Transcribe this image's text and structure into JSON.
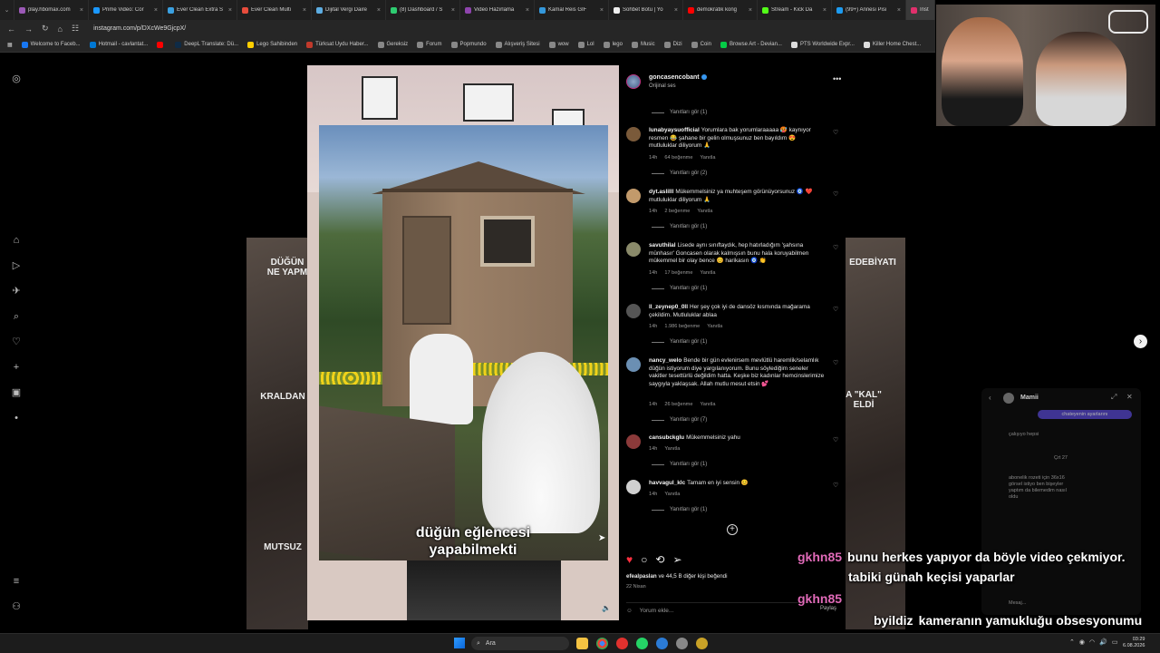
{
  "browser": {
    "tabs": [
      {
        "label": "play.hbomax.com",
        "color": "#9b59b6"
      },
      {
        "label": "Prime Video: Cor",
        "color": "#1a98ff"
      },
      {
        "label": "Ever Clean Extra S",
        "color": "#3aa0e0"
      },
      {
        "label": "Ever Clean Multi",
        "color": "#e74c3c"
      },
      {
        "label": "Dijital Vergi Daire",
        "color": "#5dade2"
      },
      {
        "label": "(8) Dashboard / S",
        "color": "#2ecc71"
      },
      {
        "label": "Video Hazırlama",
        "color": "#8e44ad"
      },
      {
        "label": "Kamal Reis GIF",
        "color": "#3498db"
      },
      {
        "label": "Sohbet Botu | Yo",
        "color": "#eeeeee"
      },
      {
        "label": "demokratik kong",
        "color": "#ff0000"
      },
      {
        "label": "Stream - Kick Da",
        "color": "#53fc18"
      },
      {
        "label": "(99+) Annesi Pisı",
        "color": "#1d9bf0"
      },
      {
        "label": "Inst",
        "color": "#e1306c"
      }
    ],
    "url": "instagram.com/p/DXcWe9GjcpX/",
    "bookmarks": [
      {
        "label": "Welcome to Faceb...",
        "color": "#1877f2"
      },
      {
        "label": "Hotmail - cavlantat...",
        "color": "#0078d4"
      },
      {
        "label": "",
        "color": "#ff0000"
      },
      {
        "label": "DeepL Translate: Dü...",
        "color": "#0f2b46"
      },
      {
        "label": "Lego Sahibinden",
        "color": "#ffcf00"
      },
      {
        "label": "Türksat Uydu Haber...",
        "color": "#c0392b"
      },
      {
        "label": "Gereksiz",
        "color": "#888888"
      },
      {
        "label": "Forum",
        "color": "#888888"
      },
      {
        "label": "Popmundo",
        "color": "#888888"
      },
      {
        "label": "Alışveriş Sitesi",
        "color": "#888888"
      },
      {
        "label": "wow",
        "color": "#888888"
      },
      {
        "label": "Lol",
        "color": "#888888"
      },
      {
        "label": "lego",
        "color": "#888888"
      },
      {
        "label": "Music",
        "color": "#888888"
      },
      {
        "label": "Dizi",
        "color": "#888888"
      },
      {
        "label": "Coin",
        "color": "#888888"
      },
      {
        "label": "Browse Art - Devian...",
        "color": "#05cc47"
      },
      {
        "label": "PTS Worldwide Expr...",
        "color": "#dddddd"
      },
      {
        "label": "Killer Home Chest...",
        "color": "#dddddd"
      }
    ]
  },
  "reel": {
    "caption": "düğün eğlencesi yapabilmekti"
  },
  "side_captions": {
    "left_top": "DÜĞÜN NE YAPM",
    "left_mid": "KRALDAN",
    "left_bottom": "MUTSUZ",
    "right_top": "EDEBİYATI",
    "right_mid": "A \"KAL\" ELDİ"
  },
  "post": {
    "username": "goncasencobant",
    "audio": "Orijinal ses",
    "likes_by": "efealpaslan",
    "likes_rest": " ve 44,5 B diğer kişi beğendi",
    "date": "22 Nisan",
    "comment_placeholder": "Yorum ekle...",
    "share": "Paylaş"
  },
  "comments": [
    {
      "user": "lunabyaysuofficial",
      "text": "Yorumlara bak yorumlaraaaaa 🥵 kaynıyor resmen 😂 şahane bir gelin olmuşsunuz ben bayıldım 😍 mutluluklar diliyorum 🙏",
      "time": "14h",
      "likes": "64 beğenme",
      "reply": "Yanıtla",
      "replies": "Yanıtları gör (2)",
      "avatar": "#7a5a3a"
    },
    {
      "user": "dyt.aslilll",
      "text": "Mükemmelsiniz ya muhteşem görünüyorsunuz 🧿 ❤️ mutluluklar diliyorum 🙏",
      "time": "14h",
      "likes": "2 beğenme",
      "reply": "Yanıtla",
      "replies": "Yanıtları gör (1)",
      "avatar": "#c29a6b"
    },
    {
      "user": "savuthilal",
      "text": "Lisede aynı sınıftaydık, hep hatırladığım 'şahsına münhasır' Goncasen olarak kalmışsın bunu hala koruyabilmen mükemmel bir olay bence 😊 harikasın 🧿 👏",
      "time": "14h",
      "likes": "17 beğenme",
      "reply": "Yanıtla",
      "replies": "Yanıtları gör (1)",
      "avatar": "#8a8a6a"
    },
    {
      "user": "ll_zeynep0_0ll",
      "text": "Her şey çok iyi de dansöz kısmında mağarama çekildim. Mutluluklar ablaa",
      "time": "14h",
      "likes": "1.986 beğenme",
      "reply": "Yanıtla",
      "replies": "Yanıtları gör (1)",
      "avatar": "#555555"
    },
    {
      "user": "nancy_welo",
      "text": "Bende bir gün evlenirsem mevlütlü haremlik/selamlık düğün istiyorum diye yargılanıyorum. Bunu söylediğim seneler vakitler tesettürlü değildim hatta. Keşke biz kadınlar hemcinslerimize saygıyla yaklaşsak. Allah mutlu mesut etsin 💕",
      "time": "14h",
      "likes": "26 beğenme",
      "reply": "Yanıtla",
      "replies": "Yanıtları gör (7)",
      "avatar": "#6b8fb3"
    },
    {
      "user": "cansubckglu",
      "text": "Mükemmelsiniz yahu",
      "time": "14h",
      "likes": "",
      "reply": "Yanıtla",
      "replies": "Yanıtları gör (1)",
      "avatar": "#8b3a3a"
    },
    {
      "user": "havvagul_klc",
      "text": "Tamam en iyi sensin 😊",
      "time": "14h",
      "likes": "",
      "reply": "Yanıtla",
      "replies": "Yanıtları gör (1)",
      "avatar": "#d0d0d0"
    }
  ],
  "first_replies": "Yanıtları gör (1)",
  "dm": {
    "title": "Mamii",
    "bubble": "chateyenin ayarlarını",
    "msg1": "çalışıyo hepsi",
    "msg2": "abonelik rozeti için 36x16 görsel istiyo ben bişeyler yaptım da bilemedim nasıl oldu",
    "time": "Çrt 27",
    "input": "Mesaj..."
  },
  "chat": [
    {
      "name": "gkhn85",
      "text": "bunu herkes yapıyor da böyle video çekmiyor."
    },
    {
      "name": "",
      "text": "tabiki günah keçisi yaparlar"
    },
    {
      "name": "gkhn85",
      "text": ""
    },
    {
      "name": "byildiz",
      "text": "kameranın yamukluğu obsesyonumu"
    }
  ],
  "taskbar": {
    "search": "Ara",
    "time": "03:29",
    "date": "6.08.2026"
  }
}
